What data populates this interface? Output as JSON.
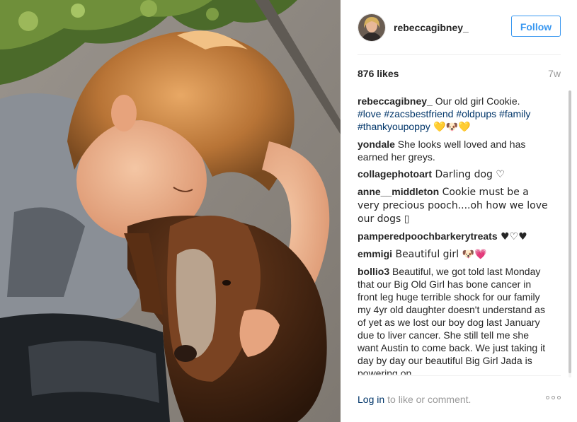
{
  "post": {
    "username": "rebeccagibney_",
    "follow_label": "Follow",
    "likes": "876 likes",
    "time": "7w",
    "photo_description_icon": "photo-icon"
  },
  "comments": [
    {
      "user": "rebeccagibney_",
      "text": " Our old girl Cookie.",
      "tags": [
        "#love",
        "#zacsbestfriend",
        "#oldpups",
        "#family",
        "#thankyoupoppy"
      ],
      "emoji": " 💛🐶💛"
    },
    {
      "user": "yondale",
      "text": " She looks well loved and has earned her greys."
    },
    {
      "user": "collagephotoart",
      "text": " Darling dog ♡"
    },
    {
      "user": "anne__middleton",
      "text": " Cookie must be a very precious pooch....oh how we love our dogs ▯"
    },
    {
      "user": "pamperedpoochbarkerytreats",
      "text": " ♥♡♥"
    },
    {
      "user": "emmigi",
      "text": " Beautiful girl 🐶💗"
    },
    {
      "user": "bollio3",
      "text": " Beautiful, we got told last Monday that our Big Old Girl has bone cancer in front leg huge terrible shock for our family my 4yr old daughter doesn't understand as of yet as we lost our boy dog last January due to liver cancer. She still tell me she want Austin to come back. We just taking it day by day our beautiful Big Girl Jada is powering on"
    }
  ],
  "footer": {
    "login_label": "Log in",
    "login_rest": "to like or comment."
  },
  "colors": {
    "link": "#003569",
    "follow": "#3897f0",
    "muted": "#999999"
  }
}
